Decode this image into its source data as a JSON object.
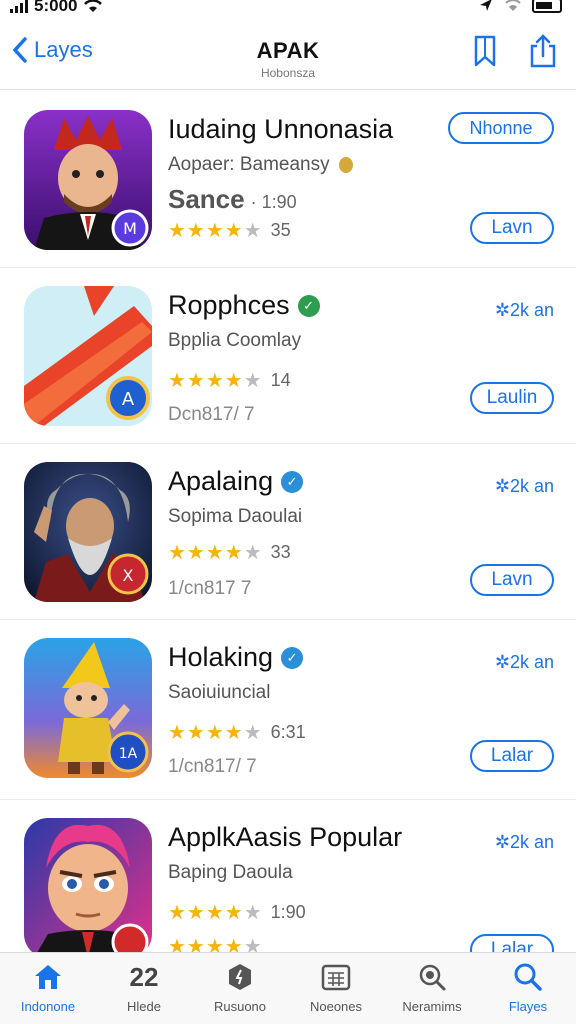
{
  "status": {
    "time": "5:000"
  },
  "nav": {
    "back_label": "Layes",
    "title": "APAK",
    "subtitle": "Hobonsza"
  },
  "apps": [
    {
      "name": "Iudaing Unnonasia",
      "subtitle": "Aopaer: Bameansy",
      "line3_main": "Sance",
      "line3_small": "· 1:90",
      "rating_count": "35",
      "top_button": "Nhonne",
      "button": "Lavn",
      "colors": {
        "bg1": "#7a2ab8",
        "bg2": "#3a0f6e",
        "badge": "#5b3ae0"
      }
    },
    {
      "name": "Ropphces",
      "subtitle": "Bpplia Coomlay",
      "rating_count": "14",
      "line3": "Dcn817/ 7",
      "size": "✲2k an",
      "button": "Laulin",
      "colors": {
        "bg1": "#bfe8f1",
        "bg2": "#e9432a",
        "badge": "#1f5fd0",
        "verified": "#2e9d4f"
      }
    },
    {
      "name": "Apalaing",
      "subtitle": "Sopima Daoulai",
      "rating_count": "33",
      "line3": "1/cn817 7",
      "size": "✲2k an",
      "button": "Lavn",
      "colors": {
        "bg1": "#1b2a55",
        "bg2": "#8a1d1d",
        "badge": "#c6262e",
        "verified": "#2a8fd8"
      }
    },
    {
      "name": "Holaking",
      "subtitle": "Saoiuiuncial",
      "rating_count": "6:31",
      "line3": "1/cn817/ 7",
      "size": "✲2k an",
      "button": "Lalar",
      "colors": {
        "bg1": "#2aa3e6",
        "bg2": "#f08a2c",
        "badge": "#1f4fc0",
        "verified": "#2a8fd8"
      }
    },
    {
      "name": "ApplkAasis Popular",
      "subtitle": "Baping Daoula",
      "rating_count": "1:90",
      "size": "✲2k an",
      "button": "Lalar",
      "colors": {
        "bg1": "#2a3aa8",
        "bg2": "#e2308a",
        "badge": "#d22a2a"
      }
    }
  ],
  "tabs": [
    {
      "label": "Indonone",
      "icon": "home-icon"
    },
    {
      "label": "Hlede",
      "icon": "numbers-icon"
    },
    {
      "label": "Rusuono",
      "icon": "shield-icon"
    },
    {
      "label": "Noeones",
      "icon": "calendar-icon"
    },
    {
      "label": "Neramims",
      "icon": "magnifier-icon"
    },
    {
      "label": "Flayes",
      "icon": "search-icon"
    }
  ],
  "accent_color": "#1a73e8"
}
